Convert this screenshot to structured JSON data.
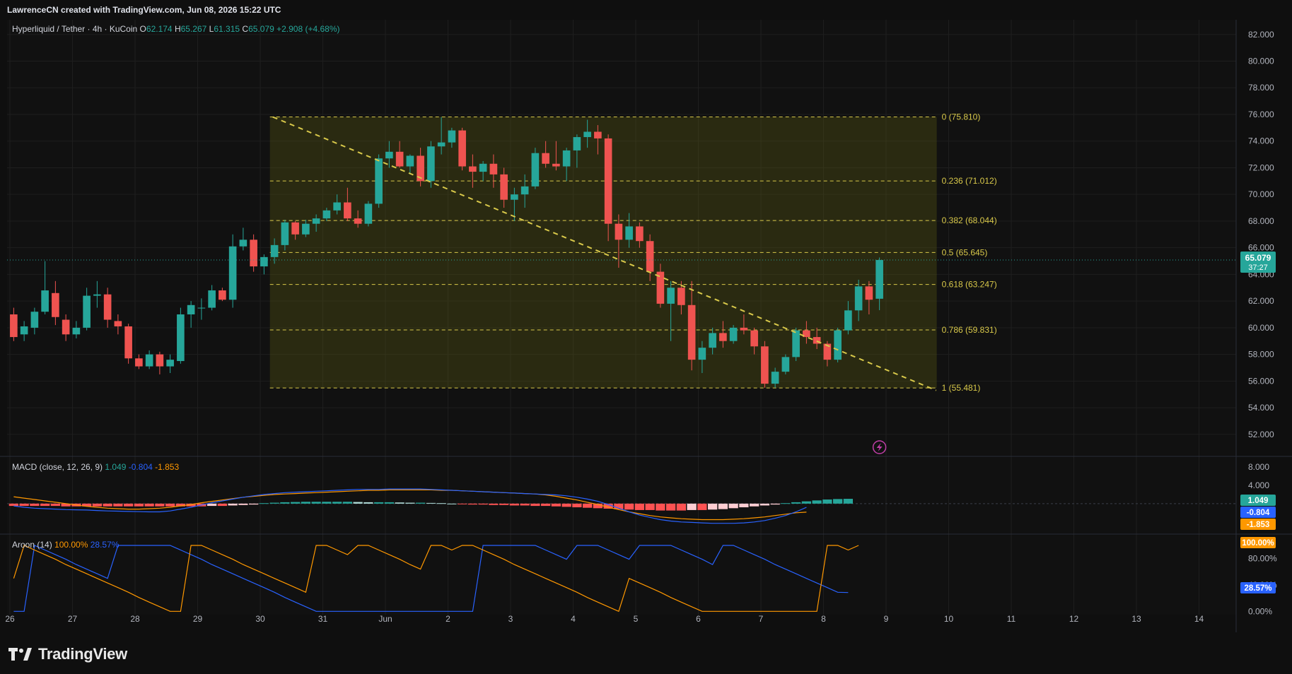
{
  "header": {
    "attribution": "LawrenceCN created with TradingView.com, Jun 08, 2026 15:22 UTC"
  },
  "legend": {
    "symbol": "Hyperliquid / Tether · 4h · KuCoin",
    "o_label": "O",
    "o_value": "62.174",
    "h_label": "H",
    "h_value": "65.267",
    "l_label": "L",
    "l_value": "61.315",
    "c_label": "C",
    "c_value": "65.079",
    "change": "+2.908 (+4.68%)",
    "macd_title": "MACD (close, 12, 26, 9)",
    "macd_hist": "1.049",
    "macd_line": "-0.804",
    "macd_signal": "-1.853",
    "aroon_title": "Aroon (14)",
    "aroon_up": "100.00%",
    "aroon_down": "28.57%"
  },
  "price_tag": {
    "price": "65.079",
    "countdown": "37:27"
  },
  "footer": {
    "brand": "TradingView"
  },
  "colors": {
    "up": "#26a69a",
    "down": "#ef5350",
    "fib_line": "#d9c94a",
    "fib_zone": "#6b6b12",
    "macd_line": "#2962ff",
    "signal_line": "#ff9800",
    "aroon_up": "#ff9800",
    "aroon_down": "#2962ff",
    "icon": "#c13ea8"
  },
  "chart_data": [
    {
      "type": "candlestick",
      "title": "Hyperliquid / Tether · 4h · KuCoin",
      "y_ticks": [
        "82.000",
        "80.000",
        "78.000",
        "76.000",
        "74.000",
        "72.000",
        "70.000",
        "68.000",
        "66.000",
        "64.000",
        "62.000",
        "60.000",
        "58.000",
        "56.000",
        "54.000",
        "52.000"
      ],
      "x_ticks": [
        "26",
        "27",
        "28",
        "29",
        "30",
        "31",
        "Jun",
        "2",
        "3",
        "4",
        "5",
        "6",
        "7",
        "8",
        "9",
        "10",
        "11",
        "12",
        "13",
        "14"
      ],
      "ylim": [
        50.4,
        83.1
      ],
      "grid": true,
      "candles": [
        {
          "o": 61.0,
          "h": 61.5,
          "l": 59.0,
          "c": 59.3
        },
        {
          "o": 59.5,
          "h": 60.5,
          "l": 59.0,
          "c": 60.1
        },
        {
          "o": 60.0,
          "h": 61.5,
          "l": 59.5,
          "c": 61.2
        },
        {
          "o": 61.2,
          "h": 65.0,
          "l": 61.0,
          "c": 62.8
        },
        {
          "o": 62.6,
          "h": 63.5,
          "l": 60.2,
          "c": 60.8
        },
        {
          "o": 60.6,
          "h": 61.0,
          "l": 59.0,
          "c": 59.5
        },
        {
          "o": 59.5,
          "h": 60.5,
          "l": 59.2,
          "c": 60.0
        },
        {
          "o": 60.0,
          "h": 63.0,
          "l": 59.8,
          "c": 62.4
        },
        {
          "o": 62.4,
          "h": 63.5,
          "l": 61.5,
          "c": 62.5
        },
        {
          "o": 62.5,
          "h": 63.0,
          "l": 60.0,
          "c": 60.6
        },
        {
          "o": 60.5,
          "h": 61.0,
          "l": 59.5,
          "c": 60.1
        },
        {
          "o": 60.1,
          "h": 60.3,
          "l": 57.3,
          "c": 57.7
        },
        {
          "o": 57.7,
          "h": 58.0,
          "l": 56.9,
          "c": 57.1
        },
        {
          "o": 57.1,
          "h": 58.3,
          "l": 56.9,
          "c": 58.0
        },
        {
          "o": 58.0,
          "h": 58.2,
          "l": 56.5,
          "c": 57.1
        },
        {
          "o": 57.1,
          "h": 58.0,
          "l": 56.6,
          "c": 57.6
        },
        {
          "o": 57.5,
          "h": 61.5,
          "l": 57.3,
          "c": 61.0
        },
        {
          "o": 61.0,
          "h": 62.0,
          "l": 60.0,
          "c": 61.7
        },
        {
          "o": 61.5,
          "h": 62.2,
          "l": 60.6,
          "c": 61.5
        },
        {
          "o": 61.5,
          "h": 63.2,
          "l": 61.3,
          "c": 62.8
        },
        {
          "o": 62.8,
          "h": 63.0,
          "l": 62.0,
          "c": 62.1
        },
        {
          "o": 62.1,
          "h": 67.0,
          "l": 61.5,
          "c": 66.1
        },
        {
          "o": 66.1,
          "h": 67.5,
          "l": 65.8,
          "c": 66.6
        },
        {
          "o": 66.6,
          "h": 67.0,
          "l": 64.2,
          "c": 64.6
        },
        {
          "o": 64.6,
          "h": 65.5,
          "l": 64.0,
          "c": 65.3
        },
        {
          "o": 65.3,
          "h": 66.7,
          "l": 64.8,
          "c": 66.2
        },
        {
          "o": 66.2,
          "h": 68.1,
          "l": 65.8,
          "c": 67.9
        },
        {
          "o": 67.9,
          "h": 68.0,
          "l": 66.6,
          "c": 67.0
        },
        {
          "o": 67.0,
          "h": 68.1,
          "l": 66.8,
          "c": 67.8
        },
        {
          "o": 67.8,
          "h": 68.5,
          "l": 67.2,
          "c": 68.2
        },
        {
          "o": 68.2,
          "h": 69.0,
          "l": 68.0,
          "c": 68.8
        },
        {
          "o": 68.8,
          "h": 70.0,
          "l": 68.5,
          "c": 69.4
        },
        {
          "o": 69.4,
          "h": 70.5,
          "l": 68.0,
          "c": 68.2
        },
        {
          "o": 68.2,
          "h": 68.8,
          "l": 67.5,
          "c": 67.8
        },
        {
          "o": 67.8,
          "h": 69.5,
          "l": 67.6,
          "c": 69.3
        },
        {
          "o": 69.3,
          "h": 73.0,
          "l": 69.0,
          "c": 72.7
        },
        {
          "o": 72.7,
          "h": 74.0,
          "l": 72.0,
          "c": 73.2
        },
        {
          "o": 73.2,
          "h": 74.0,
          "l": 72.0,
          "c": 72.1
        },
        {
          "o": 72.1,
          "h": 73.0,
          "l": 71.5,
          "c": 72.9
        },
        {
          "o": 72.9,
          "h": 73.5,
          "l": 70.6,
          "c": 71.0
        },
        {
          "o": 71.0,
          "h": 74.0,
          "l": 70.5,
          "c": 73.6
        },
        {
          "o": 73.6,
          "h": 75.8,
          "l": 73.0,
          "c": 73.9
        },
        {
          "o": 73.9,
          "h": 75.0,
          "l": 73.5,
          "c": 74.8
        },
        {
          "o": 74.8,
          "h": 75.0,
          "l": 71.8,
          "c": 72.1
        },
        {
          "o": 72.1,
          "h": 73.0,
          "l": 70.5,
          "c": 71.7
        },
        {
          "o": 71.7,
          "h": 72.5,
          "l": 71.0,
          "c": 72.3
        },
        {
          "o": 72.3,
          "h": 73.0,
          "l": 70.5,
          "c": 71.5
        },
        {
          "o": 71.5,
          "h": 72.0,
          "l": 69.0,
          "c": 69.6
        },
        {
          "o": 69.6,
          "h": 70.5,
          "l": 68.0,
          "c": 70.0
        },
        {
          "o": 70.0,
          "h": 71.5,
          "l": 69.0,
          "c": 70.6
        },
        {
          "o": 70.6,
          "h": 73.5,
          "l": 70.4,
          "c": 73.1
        },
        {
          "o": 73.1,
          "h": 74.0,
          "l": 72.0,
          "c": 72.3
        },
        {
          "o": 72.3,
          "h": 74.0,
          "l": 71.8,
          "c": 72.1
        },
        {
          "o": 72.1,
          "h": 73.5,
          "l": 71.0,
          "c": 73.3
        },
        {
          "o": 73.3,
          "h": 74.5,
          "l": 72.0,
          "c": 74.3
        },
        {
          "o": 74.3,
          "h": 75.6,
          "l": 73.5,
          "c": 74.7
        },
        {
          "o": 74.7,
          "h": 75.2,
          "l": 73.0,
          "c": 74.2
        },
        {
          "o": 74.2,
          "h": 74.5,
          "l": 66.5,
          "c": 67.8
        },
        {
          "o": 67.8,
          "h": 68.5,
          "l": 64.5,
          "c": 66.6
        },
        {
          "o": 66.6,
          "h": 68.6,
          "l": 66.0,
          "c": 67.6
        },
        {
          "o": 67.6,
          "h": 67.9,
          "l": 66.0,
          "c": 66.5
        },
        {
          "o": 66.5,
          "h": 67.0,
          "l": 63.5,
          "c": 64.2
        },
        {
          "o": 64.2,
          "h": 64.8,
          "l": 61.5,
          "c": 61.8
        },
        {
          "o": 61.8,
          "h": 63.5,
          "l": 59.0,
          "c": 63.0
        },
        {
          "o": 63.0,
          "h": 63.5,
          "l": 61.0,
          "c": 61.7
        },
        {
          "o": 61.7,
          "h": 63.5,
          "l": 56.8,
          "c": 57.6
        },
        {
          "o": 57.6,
          "h": 59.0,
          "l": 56.6,
          "c": 58.5
        },
        {
          "o": 58.5,
          "h": 60.0,
          "l": 58.0,
          "c": 59.6
        },
        {
          "o": 59.6,
          "h": 60.5,
          "l": 58.5,
          "c": 59.0
        },
        {
          "o": 59.0,
          "h": 60.2,
          "l": 58.8,
          "c": 60.0
        },
        {
          "o": 60.0,
          "h": 61.0,
          "l": 59.5,
          "c": 59.8
        },
        {
          "o": 59.8,
          "h": 60.0,
          "l": 58.0,
          "c": 58.6
        },
        {
          "o": 58.6,
          "h": 59.0,
          "l": 55.5,
          "c": 55.8
        },
        {
          "o": 55.8,
          "h": 57.0,
          "l": 55.5,
          "c": 56.7
        },
        {
          "o": 56.7,
          "h": 58.0,
          "l": 56.5,
          "c": 57.8
        },
        {
          "o": 57.8,
          "h": 60.0,
          "l": 57.5,
          "c": 59.8
        },
        {
          "o": 59.8,
          "h": 60.5,
          "l": 58.8,
          "c": 59.3
        },
        {
          "o": 59.3,
          "h": 60.0,
          "l": 58.4,
          "c": 58.8
        },
        {
          "o": 58.8,
          "h": 59.0,
          "l": 57.1,
          "c": 57.6
        },
        {
          "o": 57.6,
          "h": 60.0,
          "l": 57.4,
          "c": 59.8
        },
        {
          "o": 59.8,
          "h": 62.0,
          "l": 59.5,
          "c": 61.3
        },
        {
          "o": 61.3,
          "h": 63.6,
          "l": 60.5,
          "c": 63.1
        },
        {
          "o": 63.1,
          "h": 63.5,
          "l": 61.0,
          "c": 62.1
        },
        {
          "o": 62.174,
          "h": 65.267,
          "l": 61.315,
          "c": 65.079
        }
      ],
      "fib_levels": [
        {
          "ratio": "0",
          "price": 75.81,
          "label": "0 (75.810)"
        },
        {
          "ratio": "0.236",
          "price": 71.012,
          "label": "0.236 (71.012)"
        },
        {
          "ratio": "0.382",
          "price": 68.044,
          "label": "0.382 (68.044)"
        },
        {
          "ratio": "0.5",
          "price": 65.645,
          "label": "0.5 (65.645)"
        },
        {
          "ratio": "0.618",
          "price": 63.247,
          "label": "0.618 (63.247)"
        },
        {
          "ratio": "0.786",
          "price": 59.831,
          "label": "0.786 (59.831)"
        },
        {
          "ratio": "1",
          "price": 55.481,
          "label": "1 (55.481)"
        }
      ],
      "trendline": {
        "start": {
          "day": 30.2,
          "price": 75.81
        },
        "end": {
          "day": 10.8,
          "price": 55.3
        }
      },
      "current_price": 65.079
    },
    {
      "type": "line",
      "title": "MACD (close, 12, 26, 9)",
      "y_ticks": [
        "8.000",
        "4.000"
      ],
      "ylim": [
        -6.5,
        10.0
      ],
      "macd": [
        -0.5,
        -0.8,
        -1.0,
        -1.1,
        -1.2,
        -1.3,
        -1.35,
        -1.4,
        -1.5,
        -1.6,
        -1.65,
        -1.7,
        -1.75,
        -1.8,
        -1.8,
        -1.6,
        -1.2,
        -0.8,
        -0.3,
        0.2,
        0.6,
        1.0,
        1.4,
        1.7,
        2.0,
        2.2,
        2.4,
        2.5,
        2.6,
        2.7,
        2.8,
        2.9,
        3.0,
        3.1,
        3.1,
        3.1,
        3.2,
        3.2,
        3.2,
        3.2,
        3.1,
        3.0,
        2.9,
        2.8,
        2.7,
        2.6,
        2.5,
        2.4,
        2.3,
        2.2,
        2.1,
        2.0,
        1.9,
        1.7,
        1.4,
        1.0,
        0.5,
        -0.2,
        -1.0,
        -1.8,
        -2.5,
        -3.0,
        -3.5,
        -3.8,
        -4.0,
        -4.1,
        -4.2,
        -4.3,
        -4.3,
        -4.3,
        -4.2,
        -4.0,
        -3.7,
        -3.2,
        -2.6,
        -1.8,
        -0.804
      ],
      "signal": [
        1.5,
        1.2,
        0.9,
        0.6,
        0.3,
        0.0,
        -0.3,
        -0.6,
        -0.8,
        -1.0,
        -1.1,
        -1.2,
        -1.2,
        -1.1,
        -1.0,
        -0.8,
        -0.5,
        -0.2,
        0.2,
        0.5,
        0.8,
        1.1,
        1.4,
        1.6,
        1.8,
        2.0,
        2.1,
        2.2,
        2.3,
        2.4,
        2.5,
        2.6,
        2.7,
        2.8,
        2.9,
        2.9,
        3.0,
        3.0,
        3.0,
        3.0,
        3.0,
        2.9,
        2.9,
        2.8,
        2.7,
        2.6,
        2.5,
        2.4,
        2.3,
        2.2,
        2.1,
        1.9,
        1.6,
        1.2,
        0.8,
        0.3,
        -0.2,
        -0.8,
        -1.3,
        -1.8,
        -2.2,
        -2.6,
        -2.9,
        -3.1,
        -3.3,
        -3.4,
        -3.5,
        -3.5,
        -3.5,
        -3.4,
        -3.3,
        -3.1,
        -2.9,
        -2.6,
        -2.3,
        -2.0,
        -1.853
      ],
      "hist": [
        -0.5,
        -0.5,
        -0.5,
        -0.5,
        -0.5,
        -0.6,
        -0.6,
        -0.6,
        -0.6,
        -0.6,
        -0.6,
        -0.6,
        -0.6,
        -0.6,
        -0.6,
        -0.6,
        -0.6,
        -0.6,
        -0.6,
        -0.5,
        -0.5,
        -0.4,
        -0.3,
        -0.2,
        0.1,
        0.2,
        0.3,
        0.35,
        0.4,
        0.4,
        0.4,
        0.4,
        0.4,
        0.35,
        0.3,
        0.3,
        0.3,
        0.25,
        0.2,
        0.2,
        0.15,
        0.1,
        0.0,
        -0.1,
        -0.2,
        -0.2,
        -0.3,
        -0.3,
        -0.4,
        -0.4,
        -0.5,
        -0.5,
        -0.6,
        -0.7,
        -0.8,
        -0.9,
        -1.0,
        -1.1,
        -1.2,
        -1.3,
        -1.4,
        -1.4,
        -1.5,
        -1.5,
        -1.5,
        -1.4,
        -1.4,
        -1.3,
        -1.2,
        -1.0,
        -0.8,
        -0.6,
        -0.4,
        -0.2,
        0.1,
        0.3,
        0.5,
        0.7,
        0.9,
        1.0,
        1.049
      ]
    },
    {
      "type": "line",
      "title": "Aroon (14)",
      "y_ticks": [
        "80.00%",
        "40.00%",
        "0.00%"
      ],
      "ylim": [
        -5,
        115
      ],
      "aroon_up": [
        50,
        100,
        93,
        86,
        79,
        71,
        64,
        57,
        50,
        43,
        36,
        29,
        21,
        14,
        7,
        0,
        0,
        100,
        100,
        93,
        86,
        79,
        71,
        64,
        57,
        50,
        43,
        36,
        29,
        100,
        100,
        93,
        86,
        100,
        100,
        93,
        86,
        79,
        71,
        64,
        100,
        100,
        93,
        100,
        100,
        93,
        86,
        79,
        71,
        64,
        57,
        50,
        43,
        36,
        29,
        21,
        14,
        7,
        0,
        50,
        43,
        36,
        29,
        21,
        14,
        7,
        0,
        0,
        0,
        0,
        0,
        0,
        0,
        0,
        0,
        0,
        0,
        0,
        100,
        100,
        93,
        100
      ],
      "aroon_down": [
        0,
        0,
        100,
        93,
        86,
        79,
        71,
        64,
        57,
        50,
        100,
        100,
        100,
        100,
        100,
        100,
        93,
        86,
        79,
        71,
        64,
        57,
        50,
        43,
        36,
        29,
        21,
        14,
        7,
        0,
        0,
        0,
        0,
        0,
        0,
        0,
        0,
        0,
        0,
        0,
        0,
        0,
        0,
        0,
        0,
        100,
        100,
        100,
        100,
        100,
        100,
        93,
        86,
        79,
        100,
        100,
        100,
        93,
        86,
        79,
        100,
        100,
        100,
        100,
        93,
        86,
        79,
        71,
        100,
        100,
        93,
        86,
        79,
        71,
        64,
        57,
        50,
        43,
        36,
        29,
        28.57
      ]
    }
  ]
}
